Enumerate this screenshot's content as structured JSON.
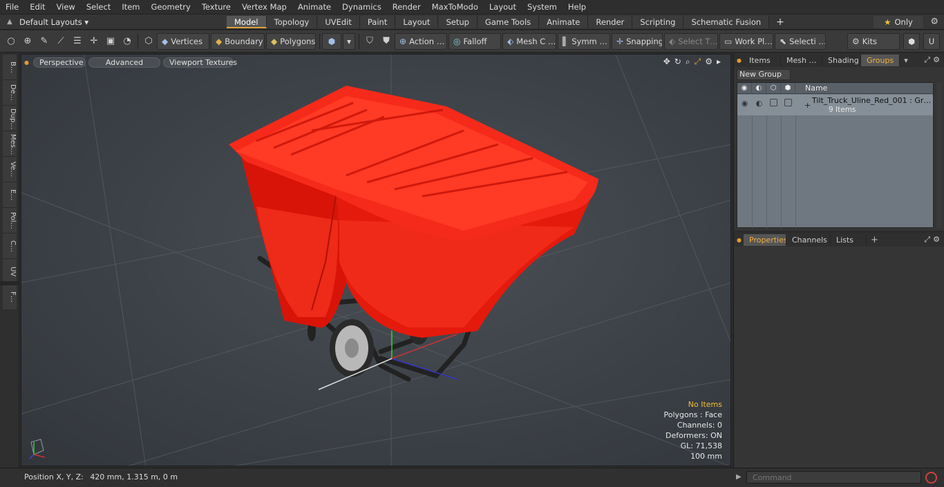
{
  "menu": [
    "File",
    "Edit",
    "View",
    "Select",
    "Item",
    "Geometry",
    "Texture",
    "Vertex Map",
    "Animate",
    "Dynamics",
    "Render",
    "MaxToModo",
    "Layout",
    "System",
    "Help"
  ],
  "tabbar": {
    "layout_label": "Default Layouts ▾",
    "tabs": [
      "Model",
      "Topology",
      "UVEdit",
      "Paint",
      "Layout",
      "Setup",
      "Game Tools",
      "Animate",
      "Render",
      "Scripting",
      "Schematic Fusion"
    ],
    "active_tab": "Model",
    "only_label": "Only"
  },
  "toolbar": {
    "vertices": "Vertices",
    "boundary": "Boundary",
    "polygons": "Polygons",
    "action": "Action …",
    "falloff": "Falloff",
    "mesh": "Mesh C …",
    "symm": "Symm …",
    "snapping": "Snapping",
    "select_t": "Select T…",
    "work_pl": "Work Pl…",
    "selecti": "Selecti …",
    "kits": "Kits"
  },
  "left_tabs": [
    "B…",
    "De…",
    "Dup…",
    "Mes…",
    "Ve…",
    "E…",
    "Pol…",
    "C…",
    "UV",
    "F…"
  ],
  "viewport": {
    "view_mode": "Perspective",
    "shading": "Advanced",
    "textures": "Viewport Textures",
    "info": {
      "selection": "No Items",
      "polygons": "Polygons : Face",
      "channels": "Channels: 0",
      "deformers": "Deformers: ON",
      "gl": "GL: 71,538",
      "scale": "100 mm"
    }
  },
  "status": {
    "position_label": "Position X, Y, Z:",
    "position_value": "420 mm, 1.315 m, 0 m",
    "command_placeholder": "Command"
  },
  "groups_panel": {
    "tabs": [
      "Items",
      "Mesh …",
      "Shading",
      "Groups"
    ],
    "active_tab": "Groups",
    "new_group": "New Group",
    "column_name": "Name",
    "rows": [
      {
        "name": "Tilt_Truck_Uline_Red_001 : Gr…",
        "sub": "9 Items"
      }
    ]
  },
  "properties_panel": {
    "tabs": [
      "Properties",
      "Channels",
      "Lists"
    ],
    "active_tab": "Properties"
  },
  "colors": {
    "accent": "#e0a23a",
    "model_red": "#f01a10",
    "viewport_bg": "#3c4147"
  }
}
